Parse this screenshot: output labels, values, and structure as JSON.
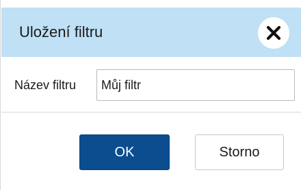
{
  "dialog": {
    "title": "Uložení filtru",
    "close_icon": "close-icon"
  },
  "form": {
    "label": "Název filtru",
    "value": "Můj filtr"
  },
  "buttons": {
    "ok_label": "OK",
    "cancel_label": "Storno"
  },
  "colors": {
    "header_bg": "#bfe0f5",
    "primary": "#0b4d8f"
  }
}
